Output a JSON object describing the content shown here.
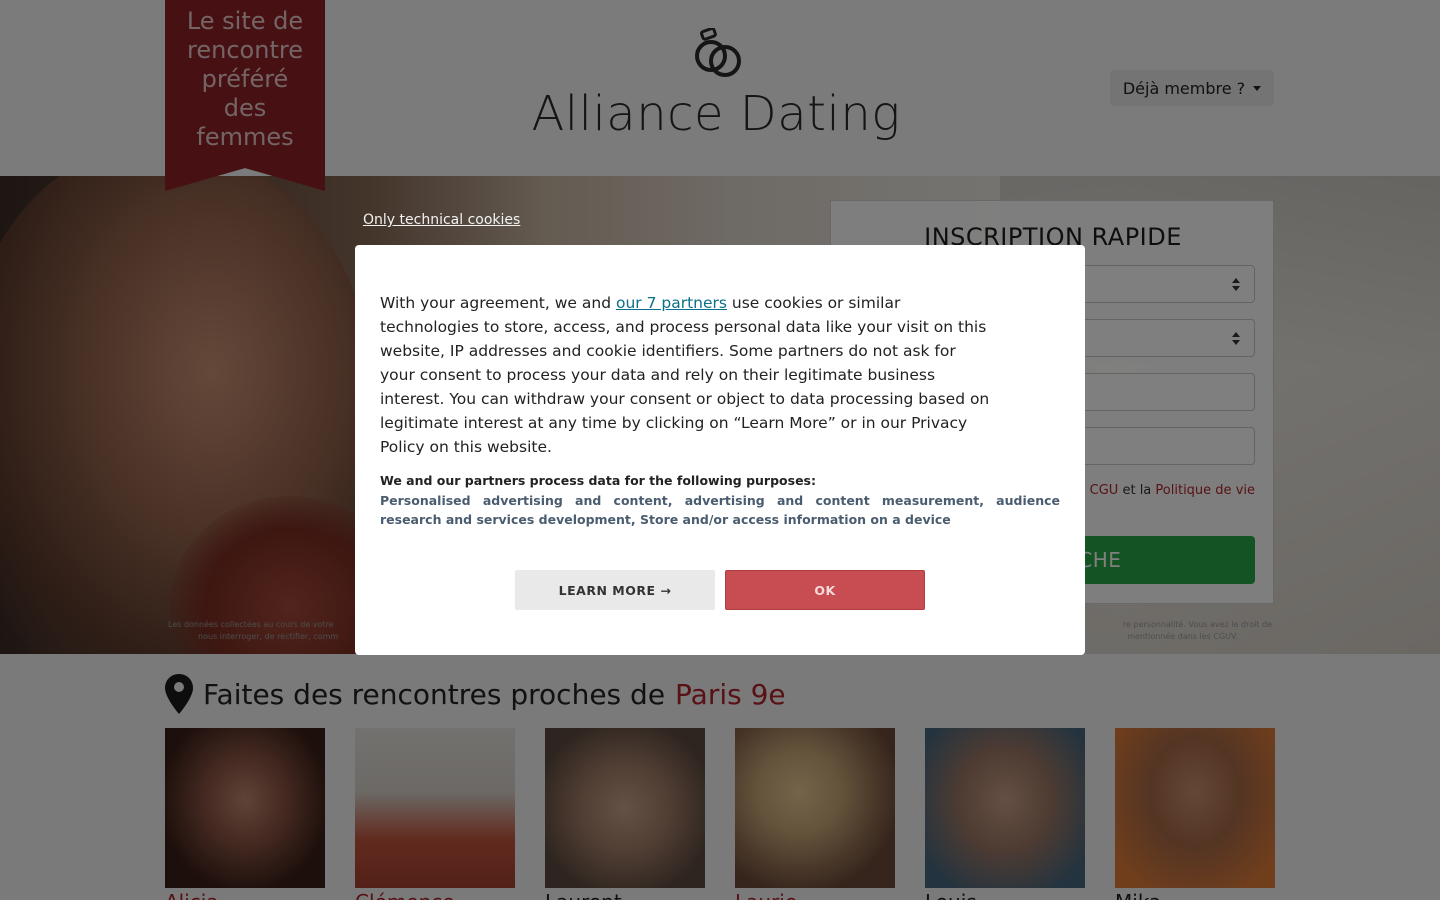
{
  "header": {
    "ribbon_lines": [
      "Le site de",
      "rencontre",
      "préféré",
      "des",
      "femmes"
    ],
    "site_title": "Alliance Dating",
    "member_button": "Déjà membre ?",
    "logo_icon": "rings-icon"
  },
  "form": {
    "title": "INSCRIPTION RAPIDE",
    "terms_link_cgu": "CGU",
    "terms_and": "et la",
    "terms_link_privacy": "Politique de vie",
    "search_button": "ECHERCHE"
  },
  "hero": {
    "legal_line1": "Les données collectées au cours de votre",
    "legal_line1_right": "re personnalité. Vous avez le droit de",
    "legal_line2": "nous interroger, de rectifier, comm",
    "legal_line2_right": "mentionnée dans les CGUV."
  },
  "results": {
    "title_prefix": "Faites des rencontres proches de",
    "city": "Paris 9e",
    "profiles": [
      {
        "name": "Alicia",
        "gender": "f"
      },
      {
        "name": "Clémence",
        "gender": "f"
      },
      {
        "name": "Laurent",
        "gender": "m"
      },
      {
        "name": "Laurie",
        "gender": "f"
      },
      {
        "name": "Louis",
        "gender": "m"
      },
      {
        "name": "Mika",
        "gender": "m"
      }
    ]
  },
  "consent": {
    "technical_link": "Only technical cookies",
    "text_before_link": "With your agreement, we and ",
    "partners_link": "our 7 partners",
    "text_after_link": " use cookies or similar technologies to store, access, and process personal data like your visit on this website, IP addresses and cookie identifiers. Some partners do not ask for your consent to process your data and rely on their legitimate business interest. You can withdraw your consent or object to data processing based on legitimate interest at any time by clicking on “Learn More” or in our Privacy Policy on this website.",
    "purposes_head": "We and our partners process data for the following purposes:",
    "purposes_list": "Personalised advertising and content, advertising and content measurement, audience research and services development, Store and/or access information on a device",
    "learn_more": "LEARN MORE →",
    "ok": "OK"
  },
  "colors": {
    "brand_red": "#8e2328",
    "link_red": "#b0252b",
    "search_green": "#28a745",
    "ok_button": "#c84d52"
  }
}
